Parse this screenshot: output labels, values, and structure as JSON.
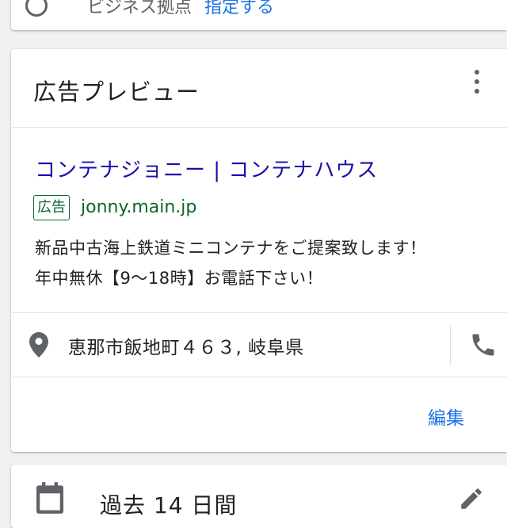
{
  "top_card": {
    "text": "ビジネス拠点",
    "link": "指定する"
  },
  "ad_preview": {
    "title": "広告プレビュー",
    "ad": {
      "headline": "コンテナジョニー | コンテナハウス",
      "badge": "広告",
      "display_url": "jonny.main.jp",
      "description_line1": "新品中古海上鉄道ミニコンテナをご提案致します！",
      "description_line2": "年中無休【9〜18時】お電話下さい！"
    },
    "location": {
      "address": "恵那市飯地町４６３, 岐阜県"
    },
    "edit_label": "編集"
  },
  "bottom_card": {
    "period_label": "過去 14 日間"
  },
  "colors": {
    "headline": "#1a0dab",
    "ad_green": "#0d652d",
    "accent_blue": "#1a73e8",
    "icon_gray": "#5f6368"
  },
  "icons": [
    "radio-circle-icon",
    "more-vert-icon",
    "location-pin-icon",
    "phone-icon",
    "calendar-icon",
    "pencil-icon"
  ]
}
